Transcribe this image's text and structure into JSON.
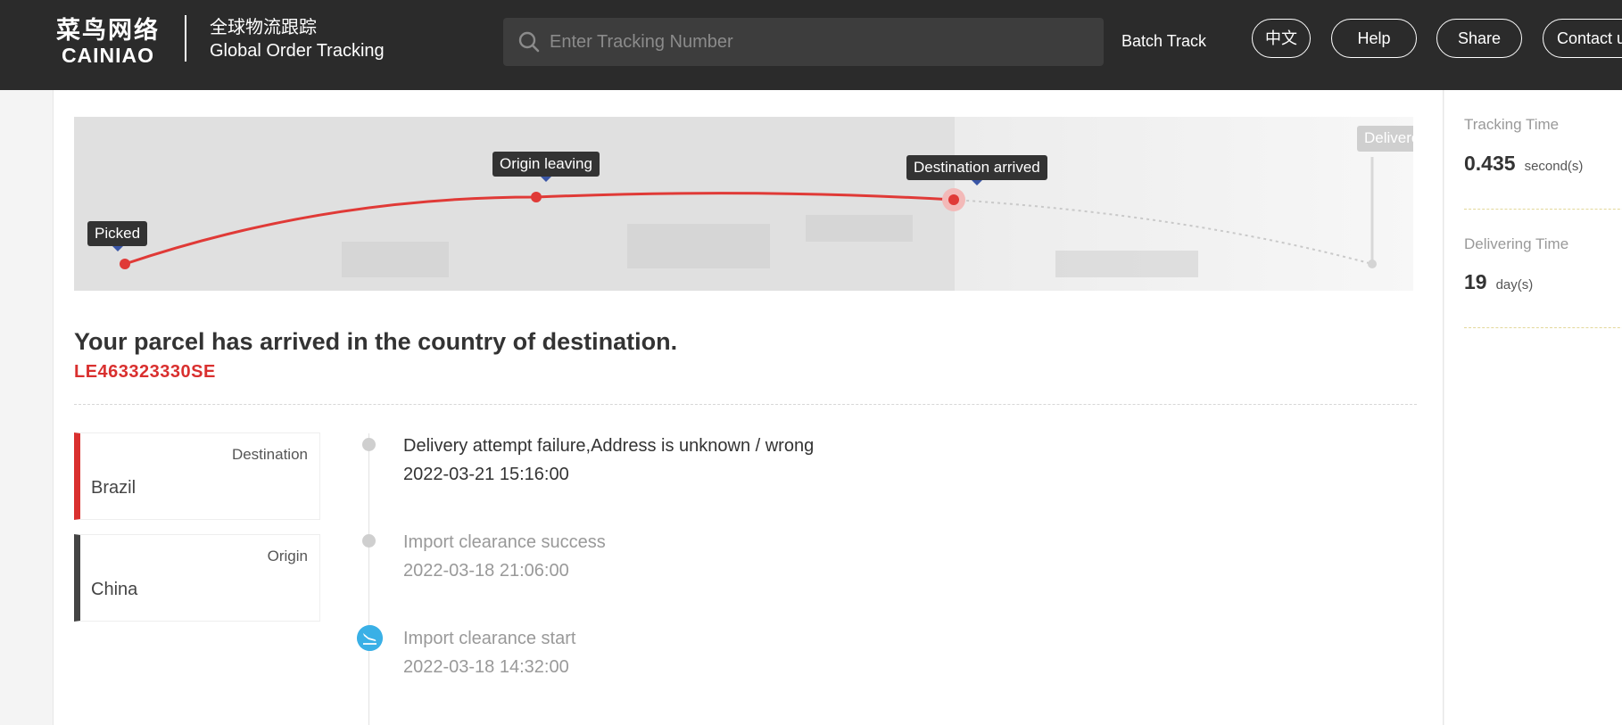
{
  "header": {
    "logo_cn": "菜鸟网络",
    "logo_en": "CAINIAO",
    "title_cn": "全球物流跟踪",
    "title_en": "Global Order Tracking",
    "search_placeholder": "Enter Tracking Number",
    "batch_track": "Batch Track",
    "lang_button": "中文",
    "help_button": "Help",
    "share_button": "Share",
    "contact_button": "Contact us"
  },
  "progress": {
    "stages": [
      "Picked",
      "Origin leaving",
      "Destination arrived",
      "Delivered"
    ],
    "current_stage": "Destination arrived"
  },
  "parcel": {
    "status_text": "Your parcel has arrived in the country of destination.",
    "tracking_number": "LE463323330SE"
  },
  "locations": {
    "destination_label": "Destination",
    "destination_value": "Brazil",
    "origin_label": "Origin",
    "origin_value": "China"
  },
  "events": [
    {
      "title": "Delivery attempt failure,Address is unknown / wrong",
      "time": "2022-03-21 15:16:00"
    },
    {
      "title": "Import clearance success",
      "time": "2022-03-18 21:06:00"
    },
    {
      "title": "Import clearance start",
      "time": "2022-03-18 14:32:00"
    }
  ],
  "stats": {
    "tracking_time_label": "Tracking Time",
    "tracking_time_value": "0.435",
    "tracking_time_unit": "second(s)",
    "delivering_time_label": "Delivering Time",
    "delivering_time_value": "19",
    "delivering_time_unit": "day(s)"
  },
  "colors": {
    "accent_red": "#d9302f",
    "topbar_bg": "#2b2b2b",
    "event_icon_blue": "#3ab0e6"
  }
}
